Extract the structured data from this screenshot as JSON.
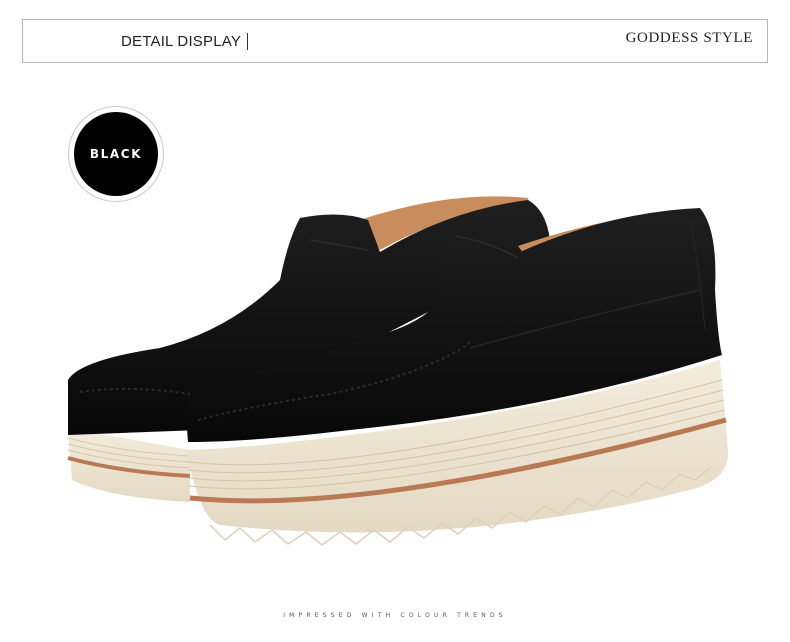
{
  "header": {
    "left_title": "DETAIL DISPLAY",
    "right_title": "GODDESS STYLE"
  },
  "color_badge": {
    "label": "BLACK",
    "color": "#000000"
  },
  "product": {
    "icon": "platform-loafer-shoes-image",
    "upper_color": "#0f0f0f",
    "sole_color": "#efe6d4",
    "stripe_color": "#b87a55",
    "lining_color": "#c98c5c"
  },
  "footer": {
    "tagline": "IMPRESSED WITH COLOUR TRENDS"
  }
}
